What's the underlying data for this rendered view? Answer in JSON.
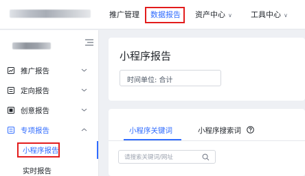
{
  "header": {
    "nav": [
      {
        "label": "推广管理"
      },
      {
        "label": "数据报告"
      },
      {
        "label": "资产中心"
      },
      {
        "label": "工具中心"
      }
    ]
  },
  "sidebar": {
    "items": [
      {
        "label": "推广报告",
        "icon": "chart-icon"
      },
      {
        "label": "定向报告",
        "icon": "target-icon"
      },
      {
        "label": "创意报告",
        "icon": "creative-icon"
      },
      {
        "label": "专项报告",
        "icon": "special-icon"
      }
    ],
    "subitems": [
      {
        "label": "小程序报告"
      },
      {
        "label": "实时报告"
      }
    ]
  },
  "main": {
    "title": "小程序报告",
    "time_unit": "时间单位: 合计",
    "tabs": [
      {
        "label": "小程序关键词"
      },
      {
        "label": "小程序搜索词"
      }
    ],
    "search_placeholder": "请搜索关键词/网址"
  },
  "colors": {
    "accent": "#2f6bff",
    "highlight_box": "#e21b1b",
    "background": "#eef0f4"
  }
}
